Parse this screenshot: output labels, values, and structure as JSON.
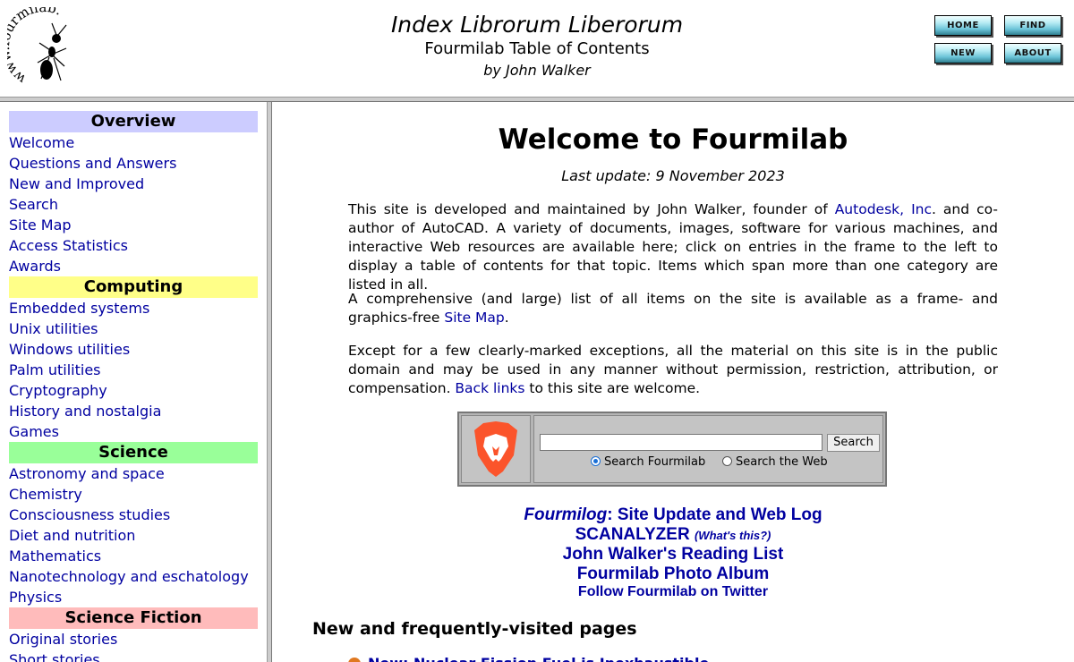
{
  "header": {
    "logo_text": "www.fourmilab.ch",
    "title": "Index Librorum Liberorum",
    "subtitle": "Fourmilab Table of Contents",
    "byline": "by John Walker",
    "nav_buttons": {
      "home": "HOME",
      "find": "FIND",
      "new": "NEW",
      "about": "ABOUT"
    }
  },
  "sidebar": {
    "sections": [
      {
        "title": "Overview",
        "color": "#ccccff",
        "items": [
          "Welcome",
          "Questions and Answers",
          "New and Improved",
          "Search",
          "Site Map",
          "Access Statistics",
          "Awards"
        ]
      },
      {
        "title": "Computing",
        "color": "#ffff88",
        "items": [
          "Embedded systems",
          "Unix utilities",
          "Windows utilities",
          "Palm utilities",
          "Cryptography",
          "History and nostalgia",
          "Games"
        ]
      },
      {
        "title": "Science",
        "color": "#99ff99",
        "items": [
          "Astronomy and space",
          "Chemistry",
          "Consciousness studies",
          "Diet and nutrition",
          "Mathematics",
          "Nanotechnology and eschatology",
          "Physics"
        ]
      },
      {
        "title": "Science Fiction",
        "color": "#ffbbbb",
        "items": [
          "Original stories",
          "Short stories"
        ]
      }
    ]
  },
  "main": {
    "title": "Welcome to Fourmilab",
    "last_update": "Last update: 9 November 2023",
    "p1": {
      "before": "This site is developed and maintained by John Walker, founder of ",
      "link": "Autodesk, Inc",
      "after": ". and co-author of AutoCAD. A variety of documents, images, software for various machines, and interactive Web resources are available here; click on entries in the frame to the left to display a table of contents for that topic. Items which span more than one category are listed in all."
    },
    "p2": {
      "before": "A comprehensive (and large) list of all items on the site is available as a frame- and graphics-free ",
      "link": "Site Map",
      "after": "."
    },
    "p3": {
      "before": "Except for a few clearly-marked exceptions, all the material on this site is in the public domain and may be used in any manner without permission, restriction, attribution, or compensation. ",
      "link": "Back links",
      "after": " to this site are welcome."
    },
    "search": {
      "input_value": "",
      "button_label": "Search",
      "options": [
        "Search Fourmilab",
        "Search the Web"
      ],
      "selected": "Search Fourmilab"
    },
    "links": {
      "fourmilog_name": "Fourmilog",
      "fourmilog_rest": ": Site Update and Web Log",
      "scanalyzer": "SCANALYZER",
      "scanalyzer_note": "(What's this?)",
      "reading_list": "John Walker's Reading List",
      "photo_album": "Fourmilab Photo Album",
      "twitter": "Follow Fourmilab on Twitter"
    },
    "new_pages_heading": "New and frequently-visited pages",
    "partial_item": "New: Nuclear Fission Fuel is Inexhaustible"
  },
  "colors": {
    "link": "#0000a0",
    "brave_orange": "#fb542b"
  },
  "icons": {
    "logo": "ant-logo-icon",
    "search_engine": "brave-lion-icon",
    "new_item": "new-item-icon"
  }
}
